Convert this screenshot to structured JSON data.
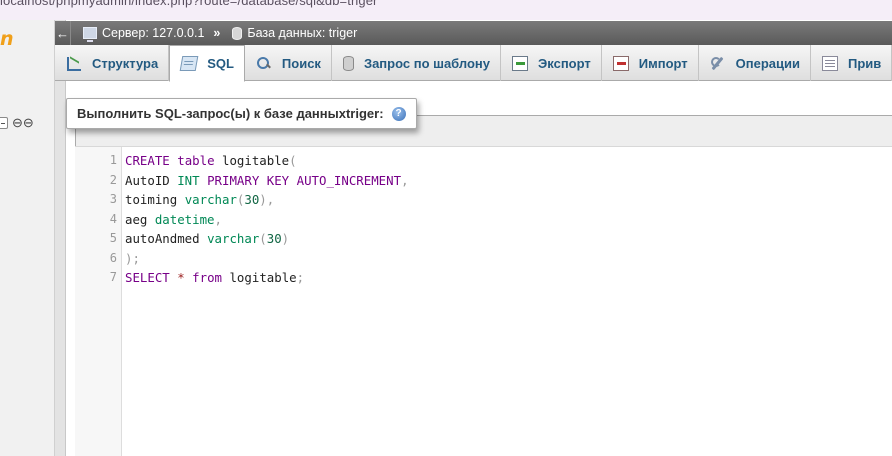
{
  "browser": {
    "url": "localhost/phpmyadmin/index.php?route=/database/sql&db=triger"
  },
  "nav": {
    "logo_fragment": "n"
  },
  "breadcrumb": {
    "back": "←",
    "server_label": "Сервер: 127.0.0.1",
    "separator": "»",
    "database_label": "База данных: triger"
  },
  "tabs": [
    {
      "label": "Структура",
      "icon": "structure-icon",
      "active": false
    },
    {
      "label": "SQL",
      "icon": "sql-icon",
      "active": true
    },
    {
      "label": "Поиск",
      "icon": "search-icon",
      "active": false
    },
    {
      "label": "Запрос по шаблону",
      "icon": "query-builder-icon",
      "active": false
    },
    {
      "label": "Экспорт",
      "icon": "export-icon",
      "active": false
    },
    {
      "label": "Импорт",
      "icon": "import-icon",
      "active": false
    },
    {
      "label": "Операции",
      "icon": "operations-icon",
      "active": false
    },
    {
      "label": "Прив",
      "icon": "privileges-icon",
      "active": false
    }
  ],
  "sql_panel": {
    "legend_prefix": "Выполнить SQL-запрос(ы) к базе данных ",
    "legend_db": "triger",
    "legend_suffix": ":",
    "help_symbol": "?"
  },
  "editor": {
    "line_numbers": [
      "1",
      "2",
      "3",
      "4",
      "5",
      "6",
      "7"
    ],
    "lines": [
      "CREATE table logitable(",
      "AutoID INT PRIMARY KEY AUTO_INCREMENT,",
      "toiming varchar(30),",
      "aeg datetime,",
      "autoAndmed varchar(30)",
      ");",
      "SELECT * from logitable;"
    ]
  },
  "colors": {
    "keyword": "#770088",
    "type": "#008855",
    "number": "#116644",
    "tab_text": "#235a81",
    "logo": "#f0a01a"
  }
}
